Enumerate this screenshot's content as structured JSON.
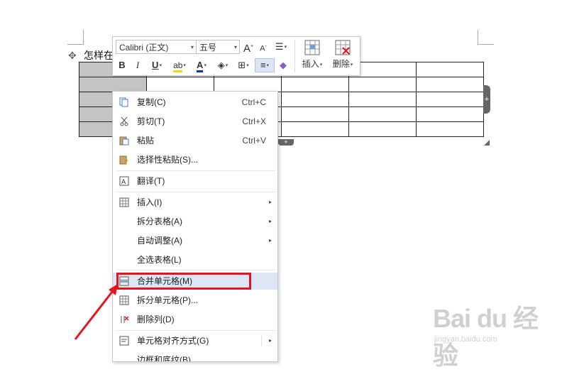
{
  "document": {
    "heading_fragment": "怎样在"
  },
  "mini_toolbar": {
    "font_name": "Calibri (正文)",
    "font_size": "五号",
    "grow_font": "A",
    "shrink_font": "A",
    "bold": "B",
    "italic": "I",
    "underline": "U",
    "highlight": "ab",
    "font_color": "A",
    "insert_label": "插入",
    "delete_label": "删除",
    "dropdown_glyph": "▾"
  },
  "context_menu": {
    "items": [
      {
        "label": "复制(C)",
        "shortcut": "Ctrl+C",
        "icon": "copy-icon"
      },
      {
        "label": "剪切(T)",
        "shortcut": "Ctrl+X",
        "icon": "cut-icon"
      },
      {
        "label": "粘贴",
        "shortcut": "Ctrl+V",
        "icon": "paste-icon"
      },
      {
        "label": "选择性粘贴(S)...",
        "shortcut": "",
        "icon": "paste-special-icon"
      },
      {
        "label": "翻译(T)",
        "shortcut": "",
        "icon": "translate-icon"
      },
      {
        "label": "插入(I)",
        "shortcut": "",
        "icon": "insert-table-icon",
        "submenu": true
      },
      {
        "label": "拆分表格(A)",
        "shortcut": "",
        "icon": "",
        "submenu": true
      },
      {
        "label": "自动调整(A)",
        "shortcut": "",
        "icon": "",
        "submenu": true
      },
      {
        "label": "全选表格(L)",
        "shortcut": "",
        "icon": ""
      },
      {
        "label": "合并单元格(M)",
        "shortcut": "",
        "icon": "merge-cells-icon",
        "highlighted": true
      },
      {
        "label": "拆分单元格(P)...",
        "shortcut": "",
        "icon": "split-cells-icon"
      },
      {
        "label": "删除列(D)",
        "shortcut": "",
        "icon": "delete-column-icon"
      },
      {
        "label": "单元格对齐方式(G)",
        "shortcut": "",
        "icon": "cell-align-icon",
        "submenu": true
      },
      {
        "label": "边框和底纹(B)...",
        "shortcut": "",
        "icon": ""
      }
    ],
    "submenu_arrow": "▸"
  },
  "table_handles": {
    "add": "+"
  },
  "watermark": {
    "logo": "Bai du 经验",
    "url": "jingyan.baidu.com"
  },
  "colors": {
    "highlight_box": "#e8141b",
    "menu_hover": "#dce6f4",
    "selected_cell": "#c4c4c4",
    "arrow": "#e8141b"
  }
}
